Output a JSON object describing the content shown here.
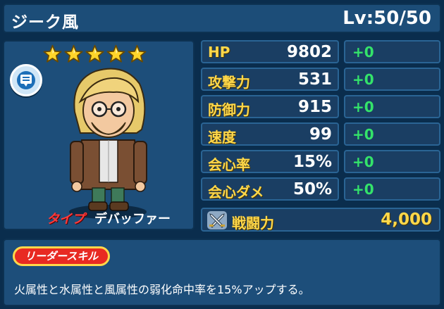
{
  "header": {
    "name": "ジーク風",
    "level": "Lv:50/50"
  },
  "character": {
    "stars": 5,
    "type_label": "タイプ",
    "type_value": "デバッファー",
    "icons": {
      "speech": "speech-bubble-icon",
      "star": "star-icon"
    }
  },
  "stats": [
    {
      "label": "HP",
      "value": "9802",
      "bonus": "+0"
    },
    {
      "label": "攻撃力",
      "value": "531",
      "bonus": "+0"
    },
    {
      "label": "防御力",
      "value": "915",
      "bonus": "+0"
    },
    {
      "label": "速度",
      "value": "99",
      "bonus": "+0"
    },
    {
      "label": "会心率",
      "value": "15%",
      "bonus": "+0"
    },
    {
      "label": "会心ダメ",
      "value": "50%",
      "bonus": "+0"
    }
  ],
  "power": {
    "label": "戦闘力",
    "value": "4,000",
    "icon": "crossed-swords-icon"
  },
  "leader_skill": {
    "badge": "リーダースキル",
    "text": "火属性と水属性と風属性の弱化命中率を15%アップする。"
  },
  "colors": {
    "background": "#0a2d4d",
    "panel": "#1d4e7a",
    "stat_label": "#ffd84a",
    "bonus": "#34e36a",
    "type_label": "#ff3a3a",
    "badge": "#e82a22"
  }
}
